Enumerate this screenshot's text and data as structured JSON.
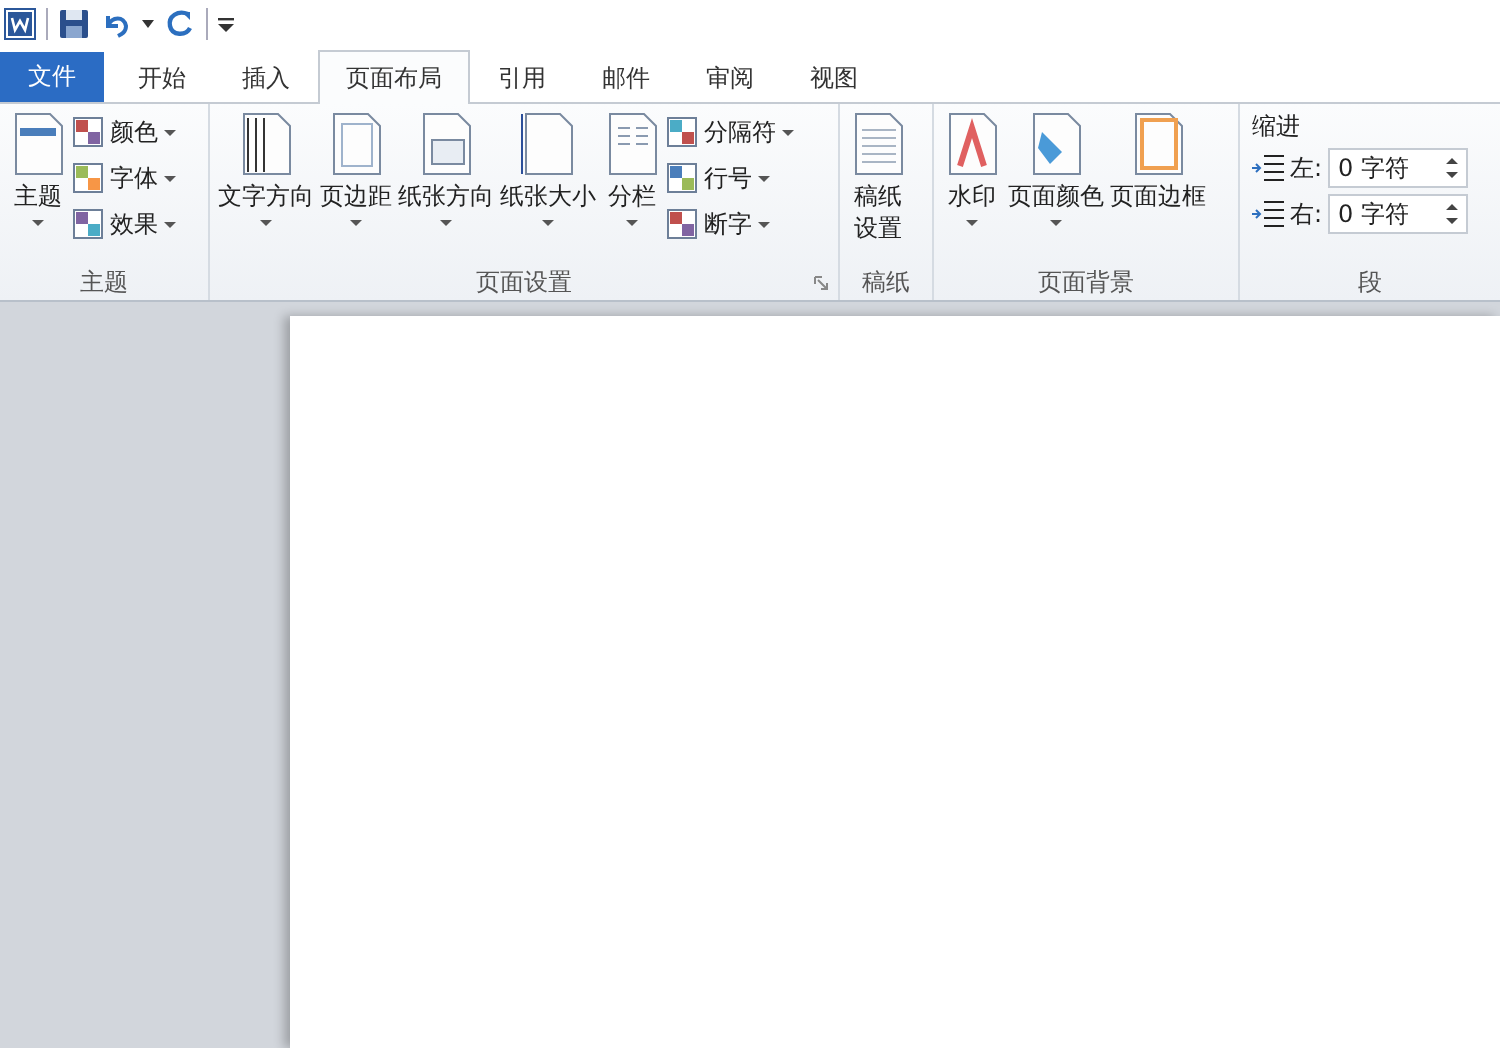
{
  "tabs": [
    {
      "label": "文件",
      "kind": "file",
      "selected": false
    },
    {
      "label": "开始",
      "kind": "tab",
      "selected": false
    },
    {
      "label": "插入",
      "kind": "tab",
      "selected": false
    },
    {
      "label": "页面布局",
      "kind": "tab",
      "selected": true
    },
    {
      "label": "引用",
      "kind": "tab",
      "selected": false
    },
    {
      "label": "邮件",
      "kind": "tab",
      "selected": false
    },
    {
      "label": "审阅",
      "kind": "tab",
      "selected": false
    },
    {
      "label": "视图",
      "kind": "tab",
      "selected": false
    }
  ],
  "groups": [
    {
      "label": "主题",
      "launcher": false,
      "items": [
        {
          "kind": "large",
          "label": "主题",
          "dropdown": true
        },
        {
          "kind": "small",
          "label": "颜色",
          "dropdown": true
        },
        {
          "kind": "small",
          "label": "字体",
          "dropdown": true
        },
        {
          "kind": "small",
          "label": "效果",
          "dropdown": true
        }
      ]
    },
    {
      "label": "页面设置",
      "launcher": true,
      "items": [
        {
          "kind": "large",
          "label": "文字方向",
          "dropdown": true
        },
        {
          "kind": "large",
          "label": "页边距",
          "dropdown": true
        },
        {
          "kind": "large",
          "label": "纸张方向",
          "dropdown": true
        },
        {
          "kind": "large",
          "label": "纸张大小",
          "dropdown": true
        },
        {
          "kind": "large",
          "label": "分栏",
          "dropdown": true
        },
        {
          "kind": "small",
          "label": "分隔符",
          "dropdown": true
        },
        {
          "kind": "small",
          "label": "行号",
          "dropdown": true
        },
        {
          "kind": "small",
          "label": "断字",
          "dropdown": true
        }
      ]
    },
    {
      "label": "稿纸",
      "launcher": false,
      "items": [
        {
          "kind": "large",
          "label": "稿纸设置",
          "dropdown": false,
          "wrap": true
        }
      ]
    },
    {
      "label": "页面背景",
      "launcher": false,
      "items": [
        {
          "kind": "large",
          "label": "水印",
          "dropdown": true
        },
        {
          "kind": "large",
          "label": "页面颜色",
          "dropdown": true
        },
        {
          "kind": "large",
          "label": "页面边框",
          "dropdown": false
        }
      ]
    },
    {
      "label": "段",
      "launcher": false,
      "items": [
        {
          "kind": "heading",
          "label": "缩进"
        },
        {
          "kind": "spinner",
          "label": "左:",
          "value": "0 字符"
        },
        {
          "kind": "spinner",
          "label": "右:",
          "value": "0 字符"
        }
      ]
    }
  ]
}
